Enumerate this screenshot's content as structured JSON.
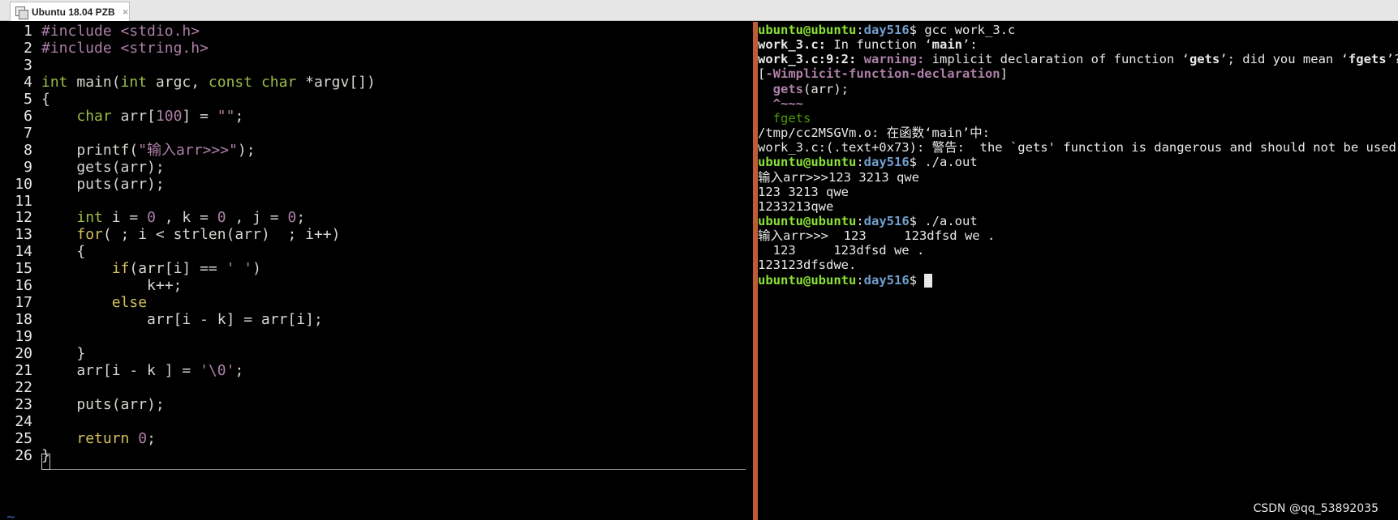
{
  "tab": {
    "label": "Ubuntu 18.04 PZB",
    "close": "×"
  },
  "editor": {
    "lines": [
      {
        "n": "1",
        "segs": [
          {
            "c": "kw-pre",
            "t": "#include"
          },
          {
            "c": "plain",
            "t": " "
          },
          {
            "c": "str",
            "t": "<stdio.h>"
          }
        ]
      },
      {
        "n": "2",
        "segs": [
          {
            "c": "kw-pre",
            "t": "#include"
          },
          {
            "c": "plain",
            "t": " "
          },
          {
            "c": "str",
            "t": "<string.h>"
          }
        ]
      },
      {
        "n": "3",
        "segs": []
      },
      {
        "n": "4",
        "segs": [
          {
            "c": "type",
            "t": "int"
          },
          {
            "c": "plain",
            "t": " main("
          },
          {
            "c": "type",
            "t": "int"
          },
          {
            "c": "plain",
            "t": " argc, "
          },
          {
            "c": "type",
            "t": "const char"
          },
          {
            "c": "plain",
            "t": " *argv[])"
          }
        ]
      },
      {
        "n": "5",
        "segs": [
          {
            "c": "plain",
            "t": "{"
          }
        ]
      },
      {
        "n": "6",
        "segs": [
          {
            "c": "plain",
            "t": "    "
          },
          {
            "c": "type",
            "t": "char"
          },
          {
            "c": "plain",
            "t": " arr["
          },
          {
            "c": "num",
            "t": "100"
          },
          {
            "c": "plain",
            "t": "] = "
          },
          {
            "c": "str",
            "t": "\"\""
          },
          {
            "c": "plain",
            "t": ";"
          }
        ]
      },
      {
        "n": "7",
        "segs": []
      },
      {
        "n": "8",
        "segs": [
          {
            "c": "plain",
            "t": "    printf("
          },
          {
            "c": "str",
            "t": "\"输入arr>>>\""
          },
          {
            "c": "plain",
            "t": ");"
          }
        ]
      },
      {
        "n": "9",
        "segs": [
          {
            "c": "plain",
            "t": "    gets(arr);"
          }
        ]
      },
      {
        "n": "10",
        "segs": [
          {
            "c": "plain",
            "t": "    puts(arr);"
          }
        ]
      },
      {
        "n": "11",
        "segs": []
      },
      {
        "n": "12",
        "segs": [
          {
            "c": "plain",
            "t": "    "
          },
          {
            "c": "type",
            "t": "int"
          },
          {
            "c": "plain",
            "t": " i = "
          },
          {
            "c": "num",
            "t": "0"
          },
          {
            "c": "plain",
            "t": " , k = "
          },
          {
            "c": "num",
            "t": "0"
          },
          {
            "c": "plain",
            "t": " , j = "
          },
          {
            "c": "num",
            "t": "0"
          },
          {
            "c": "plain",
            "t": ";"
          }
        ]
      },
      {
        "n": "13",
        "segs": [
          {
            "c": "plain",
            "t": "    "
          },
          {
            "c": "ctrl",
            "t": "for"
          },
          {
            "c": "plain",
            "t": "( ; i < strlen(arr)  ; i++)"
          }
        ]
      },
      {
        "n": "14",
        "segs": [
          {
            "c": "plain",
            "t": "    {"
          }
        ]
      },
      {
        "n": "15",
        "segs": [
          {
            "c": "plain",
            "t": "        "
          },
          {
            "c": "ctrl",
            "t": "if"
          },
          {
            "c": "plain",
            "t": "(arr[i] == "
          },
          {
            "c": "str",
            "t": "' '"
          },
          {
            "c": "plain",
            "t": ")"
          }
        ]
      },
      {
        "n": "16",
        "segs": [
          {
            "c": "plain",
            "t": "            k++;"
          }
        ]
      },
      {
        "n": "17",
        "segs": [
          {
            "c": "plain",
            "t": "        "
          },
          {
            "c": "ctrl",
            "t": "else"
          }
        ]
      },
      {
        "n": "18",
        "segs": [
          {
            "c": "plain",
            "t": "            arr[i - k] = arr[i];"
          }
        ]
      },
      {
        "n": "19",
        "segs": []
      },
      {
        "n": "20",
        "segs": [
          {
            "c": "plain",
            "t": "    }"
          }
        ]
      },
      {
        "n": "21",
        "segs": [
          {
            "c": "plain",
            "t": "    arr[i - k ] = "
          },
          {
            "c": "str",
            "t": "'\\0'"
          },
          {
            "c": "plain",
            "t": ";"
          }
        ]
      },
      {
        "n": "22",
        "segs": []
      },
      {
        "n": "23",
        "segs": [
          {
            "c": "plain",
            "t": "    puts(arr);"
          }
        ]
      },
      {
        "n": "24",
        "segs": []
      },
      {
        "n": "25",
        "segs": [
          {
            "c": "plain",
            "t": "    "
          },
          {
            "c": "ctrl",
            "t": "return"
          },
          {
            "c": "plain",
            "t": " "
          },
          {
            "c": "num",
            "t": "0"
          },
          {
            "c": "plain",
            "t": ";"
          }
        ]
      },
      {
        "n": "26",
        "segs": [
          {
            "c": "plain",
            "t": "}"
          }
        ]
      }
    ],
    "tilde": "~"
  },
  "terminal": {
    "lines": [
      [
        {
          "c": "pu",
          "t": "ubuntu@ubuntu"
        },
        {
          "c": "",
          "t": ":"
        },
        {
          "c": "pd",
          "t": "day516"
        },
        {
          "c": "",
          "t": "$ gcc work_3.c"
        }
      ],
      [
        {
          "c": "bold",
          "t": "work_3.c:"
        },
        {
          "c": "",
          "t": " In function "
        },
        {
          "c": "",
          "t": "‘"
        },
        {
          "c": "bold",
          "t": "main"
        },
        {
          "c": "",
          "t": "’:"
        }
      ],
      [
        {
          "c": "bold",
          "t": "work_3.c:9:2:"
        },
        {
          "c": "",
          "t": " "
        },
        {
          "c": "warn",
          "t": "warning:"
        },
        {
          "c": "",
          "t": " implicit declaration of function ‘"
        },
        {
          "c": "bold",
          "t": "gets"
        },
        {
          "c": "",
          "t": "’; did you mean ‘"
        },
        {
          "c": "bold",
          "t": "fgets"
        },
        {
          "c": "",
          "t": "’?"
        }
      ],
      [
        {
          "c": "",
          "t": "["
        },
        {
          "c": "warn",
          "t": "-Wimplicit-function-declaration"
        },
        {
          "c": "",
          "t": "]"
        }
      ],
      [
        {
          "c": "",
          "t": "  "
        },
        {
          "c": "warn",
          "t": "gets"
        },
        {
          "c": "",
          "t": "(arr);"
        }
      ],
      [
        {
          "c": "",
          "t": "  "
        },
        {
          "c": "warn",
          "t": "^~~~"
        }
      ],
      [
        {
          "c": "",
          "t": "  "
        },
        {
          "c": "green",
          "t": "fgets"
        }
      ],
      [
        {
          "c": "",
          "t": "/tmp/cc2MSGVm.o: 在函数‘main’中:"
        }
      ],
      [
        {
          "c": "",
          "t": "work_3.c:(.text+0x73): 警告:  the `gets' function is dangerous and should not be used."
        }
      ],
      [
        {
          "c": "pu",
          "t": "ubuntu@ubuntu"
        },
        {
          "c": "",
          "t": ":"
        },
        {
          "c": "pd",
          "t": "day516"
        },
        {
          "c": "",
          "t": "$ ./a.out"
        }
      ],
      [
        {
          "c": "",
          "t": "输入arr>>>123 3213 qwe"
        }
      ],
      [
        {
          "c": "",
          "t": "123 3213 qwe"
        }
      ],
      [
        {
          "c": "",
          "t": "1233213qwe"
        }
      ],
      [
        {
          "c": "pu",
          "t": "ubuntu@ubuntu"
        },
        {
          "c": "",
          "t": ":"
        },
        {
          "c": "pd",
          "t": "day516"
        },
        {
          "c": "",
          "t": "$ ./a.out"
        }
      ],
      [
        {
          "c": "",
          "t": "输入arr>>>  123     123dfsd we ."
        }
      ],
      [
        {
          "c": "",
          "t": "  123     123dfsd we ."
        }
      ],
      [
        {
          "c": "",
          "t": "123123dfsdwe."
        }
      ],
      [
        {
          "c": "pu",
          "t": "ubuntu@ubuntu"
        },
        {
          "c": "",
          "t": ":"
        },
        {
          "c": "pd",
          "t": "day516"
        },
        {
          "c": "",
          "t": "$ "
        }
      ]
    ]
  },
  "watermark": "CSDN @qq_53892035",
  "colors": {
    "divider": "#c15a36",
    "prompt_user": "#8ae234",
    "prompt_dir": "#729fcf",
    "warning": "#ad7fa8"
  }
}
